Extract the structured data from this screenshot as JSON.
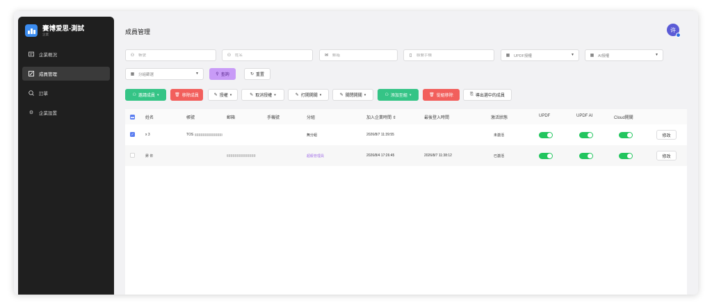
{
  "app": {
    "brand_name": "賽博爱思-測試",
    "brand_sub": "企業"
  },
  "sidebar": {
    "items": [
      {
        "label": "企業概況",
        "icon": "overview-icon",
        "active": false
      },
      {
        "label": "成員管理",
        "icon": "members-icon",
        "active": true
      },
      {
        "label": "訂單",
        "icon": "orders-icon",
        "active": false
      },
      {
        "label": "企業設置",
        "icon": "gear-icon",
        "active": false
      }
    ]
  },
  "header": {
    "title": "成員管理",
    "avatar_text": "许"
  },
  "filters": {
    "account_placeholder": "帳號",
    "name_placeholder": "姓名",
    "email_placeholder": "郵箱",
    "phone_placeholder": "聯繫手機",
    "updf_auth": "UPDF授權",
    "ai_auth": "AI授權",
    "group_filter": "分組篩選",
    "query_label": "查詢",
    "reset_label": "重置"
  },
  "toolbar": {
    "invite_label": "邀請成員",
    "remove_label": "移除成員",
    "grant_label": "授權",
    "revoke_label": "取消授權",
    "open_label": "打開開關",
    "close_label": "關閉開關",
    "add_group_label": "添加至組",
    "remove_group_label": "從組移除",
    "export_label": "導出選中的成員"
  },
  "table": {
    "columns": [
      "姓名",
      "帳號",
      "郵箱",
      "手機號",
      "分組",
      "加入企業時間 ⇕",
      "最後登入時間",
      "激活狀態",
      "UPDF",
      "UPDF AI",
      "Cloud開關"
    ],
    "rows": [
      {
        "checked": true,
        "name": "x 3",
        "account": "TOS",
        "email": "",
        "phone": "",
        "group": "無分組",
        "joined": "2026/8/7 11:39:55",
        "last_login": "",
        "status": "未激活",
        "updf": true,
        "updf_ai": true,
        "cloud": true,
        "action": "修改"
      },
      {
        "checked": false,
        "name": "昇 许",
        "account": "",
        "email": "",
        "phone": "",
        "group": "超級管理員",
        "joined": "2026/8/4 17:26:45",
        "last_login": "2026/8/7 11:38:12",
        "status": "已激活",
        "updf": true,
        "updf_ai": true,
        "cloud": true,
        "action": "修改"
      }
    ]
  },
  "colors": {
    "accent_green": "#35c486",
    "accent_red": "#f25f5c",
    "accent_purple": "#c89bf7",
    "toggle_on": "#22c55e"
  }
}
